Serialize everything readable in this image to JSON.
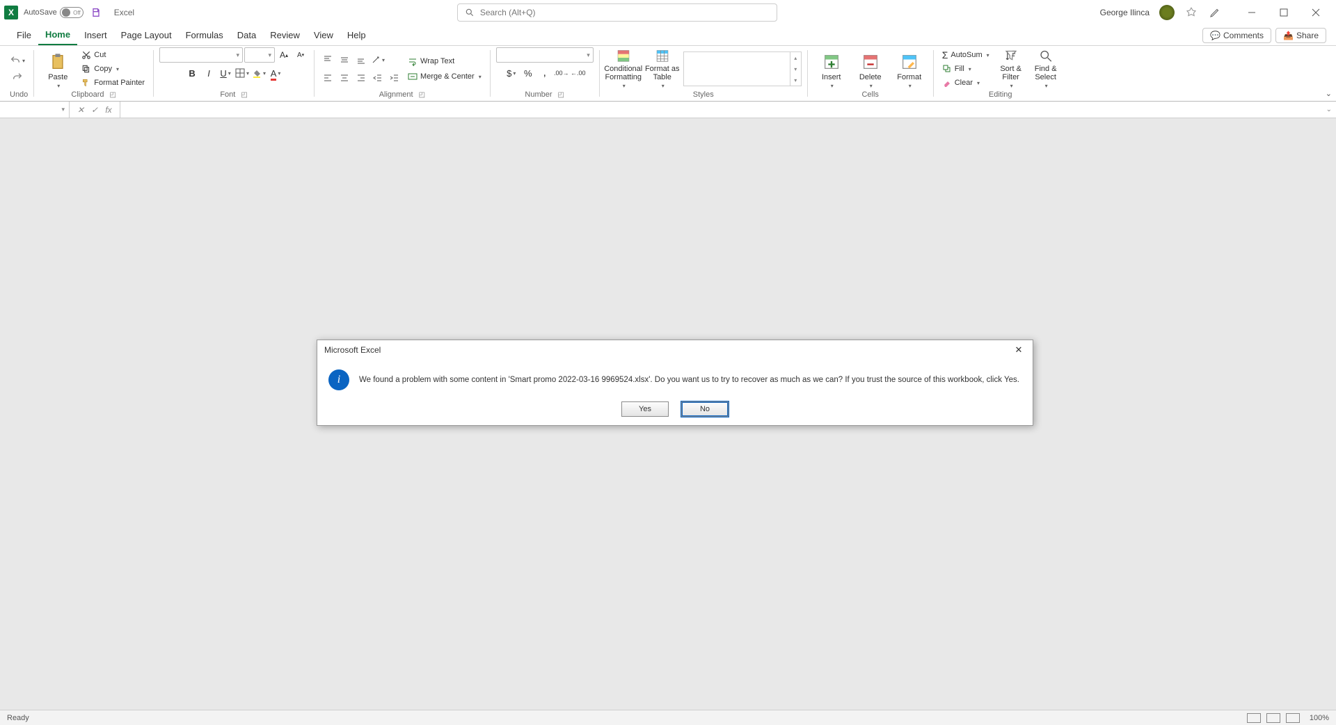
{
  "titlebar": {
    "autosave_label": "AutoSave",
    "autosave_state": "Off",
    "app_name": "Excel",
    "search_placeholder": "Search (Alt+Q)",
    "user_name": "George Ilinca"
  },
  "tabs": {
    "file": "File",
    "home": "Home",
    "insert": "Insert",
    "page_layout": "Page Layout",
    "formulas": "Formulas",
    "data": "Data",
    "review": "Review",
    "view": "View",
    "help": "Help",
    "comments": "Comments",
    "share": "Share"
  },
  "ribbon": {
    "undo": {
      "label": "Undo"
    },
    "clipboard": {
      "label": "Clipboard",
      "paste": "Paste",
      "cut": "Cut",
      "copy": "Copy",
      "format_painter": "Format Painter"
    },
    "font": {
      "label": "Font"
    },
    "alignment": {
      "label": "Alignment",
      "wrap": "Wrap Text",
      "merge": "Merge & Center"
    },
    "number": {
      "label": "Number"
    },
    "styles": {
      "label": "Styles",
      "cond": "Conditional\nFormatting",
      "table": "Format as\nTable"
    },
    "cells": {
      "label": "Cells",
      "insert": "Insert",
      "delete": "Delete",
      "format": "Format"
    },
    "editing": {
      "label": "Editing",
      "autosum": "AutoSum",
      "fill": "Fill",
      "clear": "Clear",
      "sort": "Sort &\nFilter",
      "find": "Find &\nSelect"
    }
  },
  "statusbar": {
    "ready": "Ready",
    "zoom": "100%"
  },
  "dialog": {
    "title": "Microsoft Excel",
    "message": "We found a problem with some content in 'Smart promo 2022-03-16 9969524.xlsx'. Do you want us to try to recover as much as we can? If you trust the source of this workbook, click Yes.",
    "yes": "Yes",
    "no": "No"
  }
}
